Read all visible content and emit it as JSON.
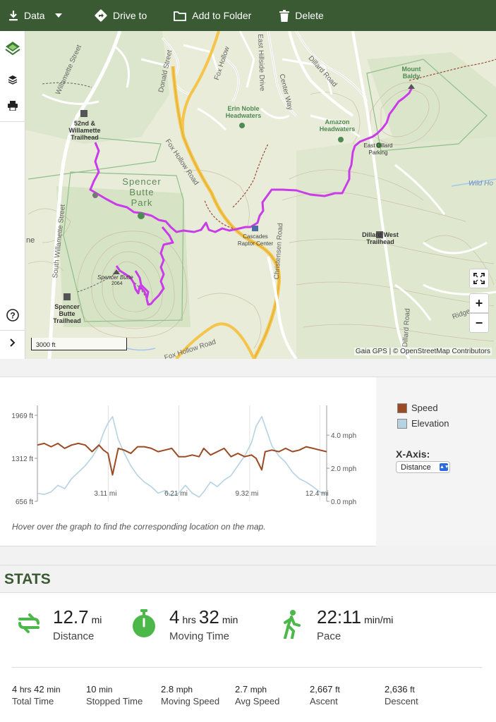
{
  "toolbar": {
    "data_label": "Data",
    "drive_label": "Drive to",
    "folder_label": "Add to Folder",
    "delete_label": "Delete"
  },
  "map": {
    "labels": {
      "park": "Spencer\nButte\nPark",
      "willamette_street": "Willamette Street",
      "south_willamette": "South Willamette Street",
      "donald_street": "Donald Street",
      "fox_hollow_road": "Fox Hollow Road",
      "fox_hollow_road_2": "Fox Hollow Road",
      "fox_hollow_road_3": "Fox Hollow",
      "hillside_drive": "East Hillside Drive",
      "center_way": "Center Way",
      "dillard_road": "Dillard Road",
      "christensen_road": "Christensen Road",
      "ridge_road": "Ridge",
      "dillard_road_2": "Dillard Road",
      "trailhead_52nd": "52nd &\nWillamette\nTrailhead",
      "trailhead_spencer": "Spencer\nButte\nTrailhead",
      "trailhead_dillard_west": "Dillard West\nTrailhead",
      "east_dillard_parking": "East Dillard\nParking",
      "amazon_headwaters": "Amazon\nHeadwaters",
      "erin_noble": "Erin Noble\nHeadwaters",
      "mount_baldy": "Mount\nBaldy",
      "spencer_butte": "Spencer Butte",
      "spencer_butte_elev": "2064",
      "cascades_raptor": "Cascades\nRaptor Center",
      "wild_hog": "Wild Ho",
      "ne_label": "ne"
    },
    "scale_label": "3000 ft",
    "attribution": "Gaia GPS | © OpenStreetMap Contributors"
  },
  "graph": {
    "hint": "Hover over the graph to find the corresponding location on the map.",
    "legend": [
      {
        "name": "Speed",
        "color": "#9b4a23"
      },
      {
        "name": "Elevation",
        "color": "#b5d3e3"
      }
    ],
    "x_axis_title": "X-Axis:",
    "x_axis_value": "Distance"
  },
  "chart_data": {
    "type": "line",
    "x_ticks": [
      "3.11 mi",
      "6.21 mi",
      "9.32 mi",
      "12.4 mi"
    ],
    "x_tick_values": [
      3.11,
      6.21,
      9.32,
      12.4
    ],
    "xlim": [
      0,
      12.7
    ],
    "y_left_ticks": [
      "1969 ft",
      "1312 ft",
      "656 ft"
    ],
    "y_left_values": [
      1969,
      1312,
      656
    ],
    "ylim_left": [
      656,
      1969
    ],
    "y_right_ticks": [
      "4.0 mph",
      "2.0 mph",
      "0.0 mph"
    ],
    "y_right_values": [
      4.0,
      2.0,
      0.0
    ],
    "ylim_right": [
      0,
      5.2
    ],
    "series": [
      {
        "name": "Elevation",
        "axis": "left",
        "color": "#b5d3e3",
        "x": [
          0,
          0.3,
          0.6,
          0.9,
          1.2,
          1.5,
          1.8,
          2.1,
          2.4,
          2.7,
          2.9,
          3.1,
          3.3,
          3.55,
          3.8,
          4.1,
          4.4,
          4.7,
          5.0,
          5.3,
          5.6,
          5.9,
          6.2,
          6.5,
          6.8,
          7.1,
          7.3,
          7.6,
          7.9,
          8.2,
          8.5,
          8.8,
          9.1,
          9.4,
          9.6,
          9.85,
          10.0,
          10.3,
          10.6,
          10.9,
          11.2,
          11.5,
          11.8,
          12.1,
          12.4,
          12.7
        ],
        "values": [
          780,
          760,
          800,
          900,
          850,
          1000,
          1100,
          1200,
          1330,
          1500,
          1700,
          1850,
          1950,
          1600,
          1400,
          1200,
          1050,
          950,
          880,
          780,
          820,
          740,
          780,
          900,
          780,
          720,
          800,
          950,
          880,
          980,
          1050,
          1200,
          1350,
          1550,
          1800,
          1950,
          1800,
          1500,
          1350,
          1250,
          1100,
          1000,
          950,
          880,
          800,
          760
        ]
      },
      {
        "name": "Speed",
        "axis": "right",
        "color": "#9b4a23",
        "x": [
          0,
          0.3,
          0.6,
          0.9,
          1.2,
          1.5,
          1.8,
          2.1,
          2.4,
          2.7,
          2.9,
          3.1,
          3.3,
          3.55,
          3.8,
          4.1,
          4.4,
          4.7,
          5.0,
          5.3,
          5.6,
          5.9,
          6.2,
          6.5,
          6.8,
          7.1,
          7.3,
          7.6,
          7.9,
          8.2,
          8.5,
          8.8,
          9.1,
          9.4,
          9.6,
          9.85,
          10.0,
          10.3,
          10.6,
          10.9,
          11.2,
          11.5,
          11.8,
          12.1,
          12.4,
          12.7
        ],
        "values": [
          3.4,
          3.5,
          3.3,
          3.5,
          3.2,
          3.4,
          3.5,
          3.4,
          3.0,
          3.4,
          3.1,
          2.9,
          1.6,
          3.2,
          3.1,
          2.9,
          3.3,
          3.3,
          3.2,
          3.0,
          3.1,
          3.2,
          2.7,
          2.7,
          2.8,
          2.7,
          3.2,
          2.8,
          3.0,
          3.2,
          2.7,
          2.9,
          2.7,
          2.8,
          2.6,
          1.9,
          3.0,
          3.1,
          3.0,
          3.2,
          3.0,
          3.1,
          3.3,
          3.2,
          3.1,
          3.0
        ]
      }
    ]
  },
  "stats": {
    "title": "STATS",
    "distance": {
      "value": "12.7",
      "unit": "mi",
      "label": "Distance"
    },
    "moving_time": {
      "hrs": "4",
      "hrs_unit": "hrs",
      "min": "32",
      "min_unit": "min",
      "label": "Moving Time"
    },
    "pace": {
      "value": "22:11",
      "unit": "min/mi",
      "label": "Pace"
    },
    "small": [
      {
        "value": "4",
        "unit": "hrs",
        "value2": "42",
        "unit2": "min",
        "label": "Total Time"
      },
      {
        "value": "10",
        "unit": "min",
        "label": "Stopped Time"
      },
      {
        "value": "2.8",
        "unit": "mph",
        "label": "Moving Speed"
      },
      {
        "value": "2.7",
        "unit": "mph",
        "label": "Avg Speed"
      },
      {
        "value": "2,667",
        "unit": "ft",
        "label": "Ascent"
      },
      {
        "value": "2,636",
        "unit": "ft",
        "label": "Descent"
      }
    ]
  }
}
